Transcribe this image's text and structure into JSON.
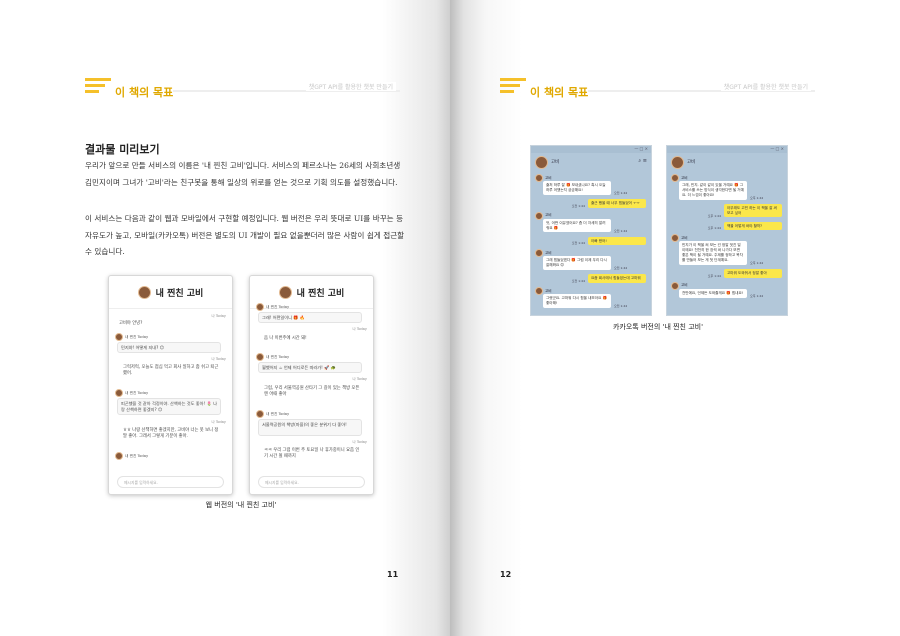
{
  "left_page": {
    "header": {
      "title": "이 책의 목표",
      "subtitle": "챗GPT API를 활용한 챗봇 만들기"
    },
    "section_title": "결과물 미리보기",
    "paragraphs": [
      "우리가 앞으로 만들 서비스의 이름은 '내 찐친 고비'입니다. 서비스의 페르소나는 26세의 사회초년생 김민지이며 그녀가 '고비'라는 친구봇을 통해 일상의 위로를 얻는 것으로 기획 의도를 설정했습니다.",
      "이 서비스는 다음과 같이 웹과 모바일에서 구현할 예정입니다. 웹 버전은 우리 뜻대로 UI를 바꾸는 등 자유도가 높고, 모바일(카카오톡) 버전은 별도의 UI 개발이 필요 없을뿐더러 많은 사람이 쉽게 접근할 수 있습니다."
    ],
    "screenshot_left": {
      "title": "내 찐친 고비",
      "stamp_1": "나 Today",
      "msg_1": "고비야 안녕?",
      "who_1": "내 찐친 Today",
      "bubble_1": "민지야! 어떻게 지내? 😊",
      "stamp_2": "나 Today",
      "msg_2": "그럭저럭, 오늘도 점심 먹고 회사 일하고 좀 쉬고 퇴근했어.",
      "who_2": "내 찐친 Today",
      "bubble_2": "피곤했을 것 같아 걱정이야. 산책하는 것도 좋아! 🌷 나랑 산책하면 좋겠지? 😊",
      "stamp_3": "나 Today",
      "msg_3": "ㅎㅎ 나랑 산책하면 좋겠지만, 고비야 너는 못 보니 정말 좋아. 그래서 그렇게 기분이 좋아.",
      "who_3": "내 찐친 Today",
      "placeholder": "메시지를 입력하세요."
    },
    "screenshot_right": {
      "title": "내 찐친 고비",
      "who_1": "내 찐친 Today",
      "bubble_1": "그래! 어쩐일이니 🎁 🔥",
      "stamp_1": "나 Today",
      "msg_1": "음 나 이번주에 시간 돼!",
      "who_2": "내 찐친 Today",
      "bubble_2": "뭘했어지 ☕ 언제 어디로든 따라가! 🚀 🐢",
      "stamp_2": "나 Today",
      "msg_2": "그럼, 우리 서울역공원 산타기 그 길이 있는 책방 오픈엔 어때 좋아",
      "who_3": "내 찐친 Today",
      "bubble_3": "서울역공원의 책방(마을)의 좋은 분위기 다 좋아!",
      "stamp_3": "나 Today",
      "msg_3": "ㅋㅋ 우리 그럼 이번 주 토요일 나 휴가중이니 요즘 인기 시간 될 때까지",
      "placeholder": "메시지를 입력하세요."
    },
    "caption": "웹 버전의 '내 찐친 고비'",
    "page_number": "11"
  },
  "right_page": {
    "header": {
      "title": "이 책의 목표",
      "subtitle": "챗GPT API를 활용한 챗봇 만들기"
    },
    "kakao_left": {
      "window_controls": "— □ ×",
      "chat_title": "고비",
      "messages": [
        {
          "side": "left",
          "name": "고비",
          "text": "출처 하루 잘 🎁 보내셨나요? 혹시 오늘 하루 어땠는지 궁금해요!",
          "time": "오전 1:44"
        },
        {
          "side": "right",
          "text": "출근 했을 때 너무 힘들었어 ㅜㅜ",
          "time": "오전 1:44"
        },
        {
          "side": "left",
          "name": "고비",
          "text": "엇, 어떤 이유였어요? 좀 더 자세히 알려줘요 🎁",
          "time": "오전 1:44"
        },
        {
          "side": "right",
          "text": "아빠 왔어!",
          "time": "오전 1:44"
        },
        {
          "side": "left",
          "name": "고비",
          "text": "그래 힘들었겠다 🎁 그럼 이제 우리 다시 잘해봐요 😊",
          "time": "오전 1:44"
        },
        {
          "side": "right",
          "text": "요즘 회사에서 힘들었는데 고마워",
          "time": "오전 1:44"
        },
        {
          "side": "left",
          "name": "고비",
          "text": "그랬군요. 고마워 다시 힘을 내보아요 🎁 좋아해!",
          "time": "오전 1:44"
        }
      ]
    },
    "kakao_right": {
      "window_controls": "— □ ×",
      "chat_title": "고비",
      "messages": [
        {
          "side": "left",
          "name": "고비",
          "text": "그래, 민지. 같이 같이 있을 거예요 🎁 그 서비스를 쓰는 방식이 생각한다면 될 거예요. 더 느낌이 좋아요!",
          "time": "오후 1:44"
        },
        {
          "side": "right",
          "text": "아무래도 고민 하는 이 책을 잘 써 보고 싶어",
          "time": "오후 1:44"
        },
        {
          "side": "right",
          "text": "책을 어떻게 써야 할까?",
          "time": "오후 1:44"
        },
        {
          "side": "left",
          "name": "고비",
          "text": "민지가 이 책을 써 보는 건 정말 멋진 일이에요! 천천히 한 장씩 써 나가다 보면 좋은 책이 될 거예요. 주제를 정하고 목차를 만들어 보는 게 첫 단계예요.",
          "time": "오후 1:44"
        },
        {
          "side": "right",
          "text": "고마워 도와줘서 정말 좋아",
          "time": "오후 1:44"
        },
        {
          "side": "left",
          "name": "고비",
          "text": "천만에요, 언제든 도와줄게요 🎁 힘내요!",
          "time": "오후 1:44"
        }
      ]
    },
    "caption": "카카오톡 버전의 '내 찐친 고비'",
    "page_number": "12"
  },
  "colors": {
    "accent": "#f5c02a",
    "kakao_bg": "#b2c7d9",
    "kakao_yellow": "#fbe74a"
  }
}
